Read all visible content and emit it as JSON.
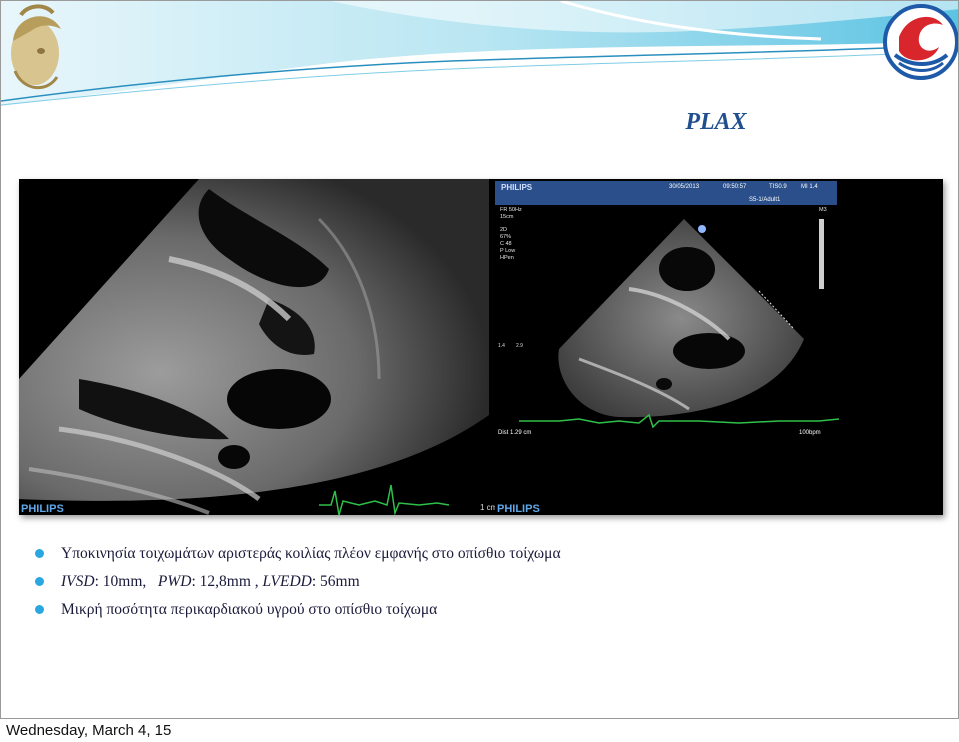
{
  "slide": {
    "title": "PLAX",
    "bullets": [
      {
        "text": "Υποκινησία τοιχωμάτων αριστεράς κοιλίας πλέον εμφανής στο οπίσθιο τοίχωμα"
      },
      {
        "parts": [
          {
            "t": "IVSD",
            "italic": true
          },
          {
            "t": ": 10mm,   ",
            "italic": false
          },
          {
            "t": "PWD",
            "italic": true
          },
          {
            "t": ": 12,8mm , ",
            "italic": false
          },
          {
            "t": "LVEDD",
            "italic": true
          },
          {
            "t": ": 56mm",
            "italic": false
          }
        ]
      },
      {
        "text": "Μικρή ποσότητα περικαρδιακού υγρού στο οπίσθιο τοίχωμα"
      }
    ]
  },
  "echo_left": {
    "brand": "PHILIPS",
    "depth_label": "1 cm"
  },
  "echo_right": {
    "brand": "PHILIPS",
    "header_brand": "PHILIPS",
    "date": "30/05/2013",
    "time": "09:50:57",
    "tis": "TIS0.9",
    "mi": "MI 1.4",
    "probe": "S5-1/Adult1",
    "params": [
      "FR 50Hz",
      "15cm",
      "2D",
      "67%",
      "C 48",
      "P Low",
      "HPen"
    ],
    "m3": "M3",
    "dist": "Dist  1.29 cm",
    "hr": "100bpm"
  },
  "footer": {
    "date": "Wednesday, March 4, 15"
  },
  "colors": {
    "title": "#1f4f8f",
    "bullet": "#29a7e1",
    "ecg": "#2fc04a"
  }
}
